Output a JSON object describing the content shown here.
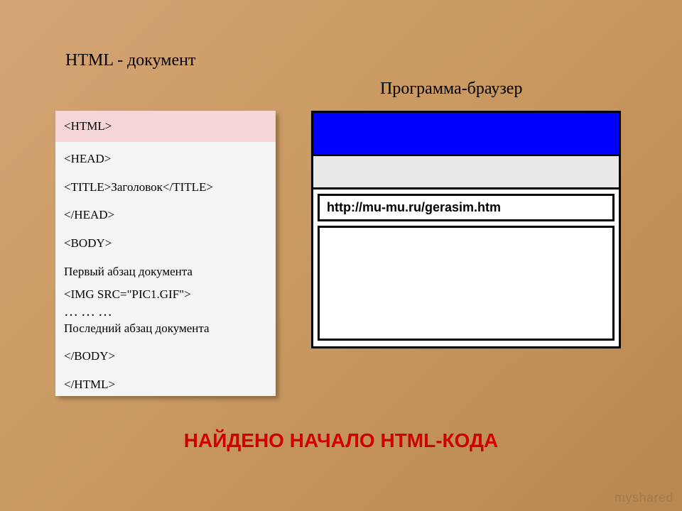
{
  "titles": {
    "left": "HTML - документ",
    "right": "Программа-браузер"
  },
  "code": {
    "html_open": "<HTML>",
    "head_open": "<HEAD>",
    "title_line": "<TITLE>Заголовок</TITLE>",
    "head_close": "</HEAD>",
    "body_open": "<BODY>",
    "first_para": "Первый абзац документа",
    "img_tag": "<IMG SRC=\"PIC1.GIF\">",
    "dots": "………",
    "last_para": "Последний абзац документа",
    "body_close": "</BODY>",
    "html_close": "</HTML>"
  },
  "browser": {
    "url": "http://mu-mu.ru/gerasim.htm"
  },
  "caption": "НАЙДЕНО НАЧАЛО HTML-КОДА",
  "watermark": "myshared"
}
